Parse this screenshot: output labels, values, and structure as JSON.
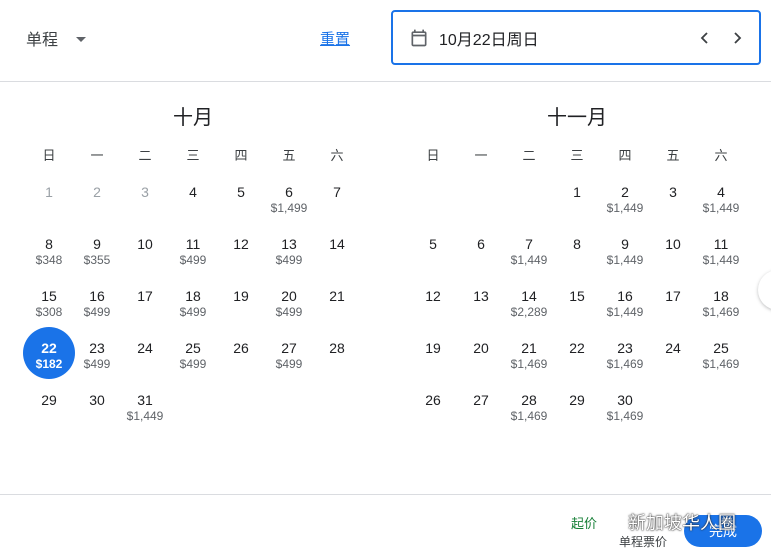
{
  "header": {
    "trip_type": "单程",
    "reset_label": "重置",
    "date_value": "10月22日周日"
  },
  "weekdays": [
    "日",
    "一",
    "二",
    "三",
    "四",
    "五",
    "六"
  ],
  "months": [
    {
      "title": "十月",
      "lead_blanks": 0,
      "days": [
        {
          "d": "1",
          "p": "",
          "past": true
        },
        {
          "d": "2",
          "p": "",
          "past": true
        },
        {
          "d": "3",
          "p": "",
          "past": true
        },
        {
          "d": "4",
          "p": ""
        },
        {
          "d": "5",
          "p": ""
        },
        {
          "d": "6",
          "p": "$1,499"
        },
        {
          "d": "7",
          "p": ""
        },
        {
          "d": "8",
          "p": "$348"
        },
        {
          "d": "9",
          "p": "$355"
        },
        {
          "d": "10",
          "p": ""
        },
        {
          "d": "11",
          "p": "$499"
        },
        {
          "d": "12",
          "p": ""
        },
        {
          "d": "13",
          "p": "$499"
        },
        {
          "d": "14",
          "p": ""
        },
        {
          "d": "15",
          "p": "$308"
        },
        {
          "d": "16",
          "p": "$499"
        },
        {
          "d": "17",
          "p": ""
        },
        {
          "d": "18",
          "p": "$499"
        },
        {
          "d": "19",
          "p": ""
        },
        {
          "d": "20",
          "p": "$499"
        },
        {
          "d": "21",
          "p": ""
        },
        {
          "d": "22",
          "p": "$182",
          "selected": true
        },
        {
          "d": "23",
          "p": "$499"
        },
        {
          "d": "24",
          "p": ""
        },
        {
          "d": "25",
          "p": "$499"
        },
        {
          "d": "26",
          "p": ""
        },
        {
          "d": "27",
          "p": "$499"
        },
        {
          "d": "28",
          "p": ""
        },
        {
          "d": "29",
          "p": ""
        },
        {
          "d": "30",
          "p": ""
        },
        {
          "d": "31",
          "p": "$1,449"
        }
      ]
    },
    {
      "title": "十一月",
      "lead_blanks": 3,
      "days": [
        {
          "d": "1",
          "p": ""
        },
        {
          "d": "2",
          "p": "$1,449"
        },
        {
          "d": "3",
          "p": ""
        },
        {
          "d": "4",
          "p": "$1,449"
        },
        {
          "d": "5",
          "p": ""
        },
        {
          "d": "6",
          "p": ""
        },
        {
          "d": "7",
          "p": "$1,449"
        },
        {
          "d": "8",
          "p": ""
        },
        {
          "d": "9",
          "p": "$1,449"
        },
        {
          "d": "10",
          "p": ""
        },
        {
          "d": "11",
          "p": "$1,449"
        },
        {
          "d": "12",
          "p": ""
        },
        {
          "d": "13",
          "p": ""
        },
        {
          "d": "14",
          "p": "$2,289"
        },
        {
          "d": "15",
          "p": ""
        },
        {
          "d": "16",
          "p": "$1,449"
        },
        {
          "d": "17",
          "p": ""
        },
        {
          "d": "18",
          "p": "$1,469"
        },
        {
          "d": "19",
          "p": ""
        },
        {
          "d": "20",
          "p": ""
        },
        {
          "d": "21",
          "p": "$1,469"
        },
        {
          "d": "22",
          "p": ""
        },
        {
          "d": "23",
          "p": "$1,469"
        },
        {
          "d": "24",
          "p": ""
        },
        {
          "d": "25",
          "p": "$1,469"
        },
        {
          "d": "26",
          "p": ""
        },
        {
          "d": "27",
          "p": ""
        },
        {
          "d": "28",
          "p": "$1,469"
        },
        {
          "d": "29",
          "p": ""
        },
        {
          "d": "30",
          "p": "$1,469"
        }
      ]
    }
  ],
  "footer": {
    "from_price": "起价",
    "price_type": "单程票价",
    "done_label": "完成",
    "watermark": "新加坡华人圈"
  },
  "colors": {
    "accent": "#1a73e8",
    "price_green": "#188038",
    "divider": "#dadce0"
  },
  "icons": {
    "trip_caret": "caret-down-icon",
    "calendar": "calendar-icon",
    "prev": "chevron-left-icon",
    "next": "chevron-right-icon"
  }
}
